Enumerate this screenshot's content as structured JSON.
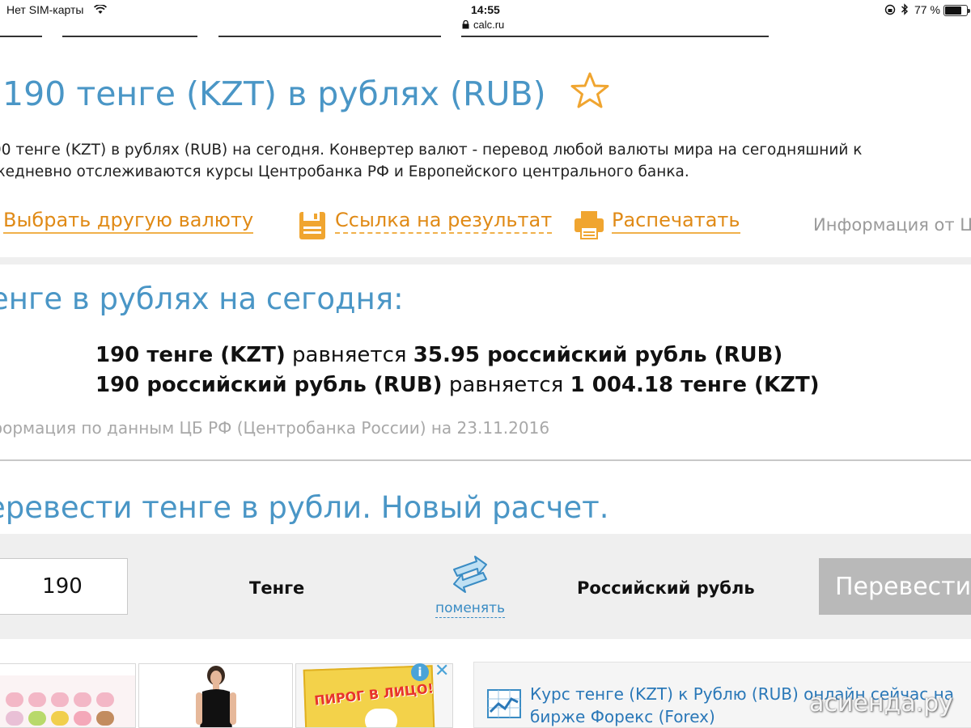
{
  "status_bar": {
    "carrier": "Нет SIM-карты",
    "time": "14:55",
    "url": "calc.ru",
    "battery": "77 %",
    "battery_level": 0.77
  },
  "page": {
    "title": ".190 тенге (KZT) в рублях (RUB)",
    "description_line1": "90 тенге (KZT) в рублях (RUB) на сегодня. Конвертер валют - перевод любой валюты мира на сегодняшний к",
    "description_line2": "жедневно отслеживаются курсы Центробанка РФ и Европейского центрального банка."
  },
  "actions": {
    "choose_currency": "Выбрать другую валюту",
    "result_link": "Ссылка на результат",
    "print": "Распечатать",
    "info_from": "Информация от Ц"
  },
  "result": {
    "heading": "енге в рублях на сегодня:",
    "line1_left": "190 тенге (KZT)",
    "line1_mid": " равняется ",
    "line1_right": "35.95 российский рубль (RUB)",
    "line2_left": "190 российский рубль (RUB)",
    "line2_mid": " равняется ",
    "line2_right": "1 004.18 тенге (KZT)",
    "source_note": "формация по данным ЦБ РФ (Центробанка России) на 23.11.2016"
  },
  "converter": {
    "heading": "еревести тенге в рубли. Новый расчет.",
    "amount": "190",
    "from_currency": "Тенге",
    "swap_label": "поменять",
    "to_currency": "Российский рубль",
    "convert_button": "Перевести"
  },
  "ads": {
    "tile3_text": "ПИРОГ В ЛИЦО!",
    "info_icon": "i",
    "close_icon": "✕"
  },
  "forex": {
    "line1": "Курс тенге (KZT) к Рублю (RUB) онлайн сейчас на",
    "line2": "бирже Форекс (Forex)"
  },
  "watermark": "асиенда.ру",
  "colors": {
    "heading_blue": "#4a96c6",
    "action_orange": "#e08a16",
    "link_blue": "#2a78b8",
    "button_gray": "#b9b9b9"
  }
}
